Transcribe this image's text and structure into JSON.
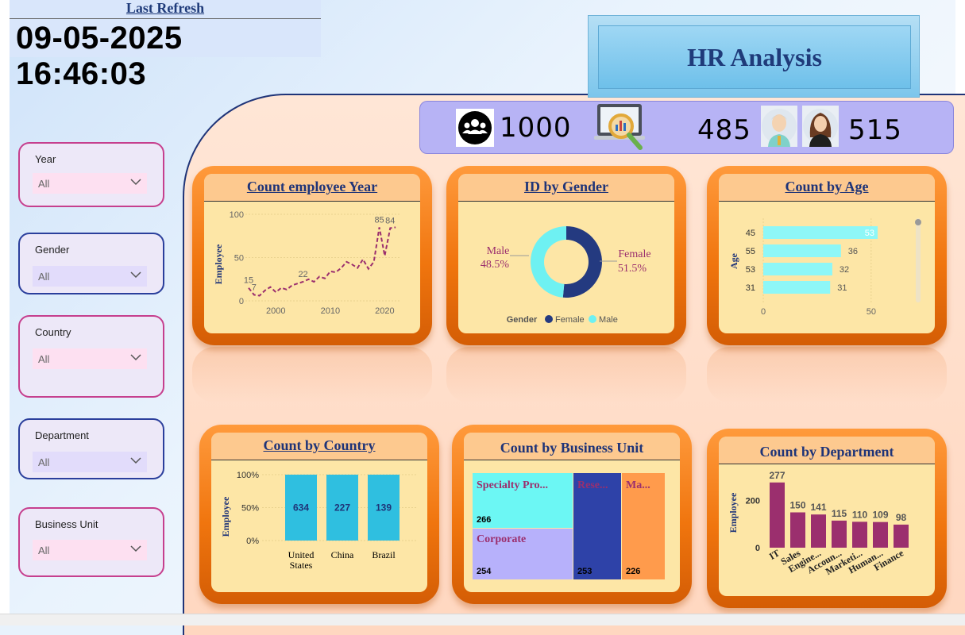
{
  "refresh": {
    "label": "Last Refresh",
    "datetime": "09-05-2025 16:46:03"
  },
  "title": "HR Analysis",
  "kpis": {
    "total": "1000",
    "male": "485",
    "female": "515"
  },
  "icons": {
    "people": "group-people-icon",
    "analytics": "analytics-magnifier-icon",
    "male": "male-avatar-icon",
    "female": "female-avatar-icon",
    "chevron": "chevron-down-icon"
  },
  "slicers": [
    {
      "label": "Year",
      "value": "All"
    },
    {
      "label": "Gender",
      "value": "All"
    },
    {
      "label": "Country",
      "value": "All"
    },
    {
      "label": "Department",
      "value": "All"
    },
    {
      "label": "Business Unit",
      "value": "All"
    }
  ],
  "cards": {
    "year": "Count employee Year",
    "gender": "ID by Gender",
    "age": "Count by Age",
    "country": "Count by Country",
    "business_unit": "Count by Business Unit",
    "department": "Count by Department"
  },
  "colors": {
    "line": "#9b2f6e",
    "donut_female": "#243a80",
    "donut_male": "#6ef1f2",
    "age_bar": "#8ef7f7",
    "country_bar": "#2fbfe0",
    "dept_bar": "#9b2f6e",
    "tm_specialty": "#6cf7f4",
    "tm_corporate": "#b7b1fb",
    "tm_research": "#2e42a8",
    "tm_manufacturing": "#ff9b4c"
  },
  "chart_data": [
    {
      "id": "year",
      "type": "line",
      "title": "Count employee Year",
      "ylabel": "Employee",
      "x_ticks": [
        "2000",
        "2010",
        "2020"
      ],
      "y_ticks": [
        "0",
        "50",
        "100"
      ],
      "ylim": [
        0,
        100
      ],
      "xlim": [
        1995,
        2023
      ],
      "x": [
        1995,
        1996,
        1997,
        1998,
        1999,
        2000,
        2001,
        2002,
        2003,
        2004,
        2005,
        2006,
        2007,
        2008,
        2009,
        2010,
        2011,
        2012,
        2013,
        2014,
        2015,
        2016,
        2017,
        2018,
        2019,
        2020,
        2021,
        2022
      ],
      "values": [
        15,
        7,
        6,
        12,
        16,
        10,
        15,
        13,
        18,
        20,
        22,
        25,
        22,
        28,
        26,
        34,
        33,
        38,
        45,
        42,
        38,
        48,
        37,
        45,
        85,
        52,
        84,
        85
      ],
      "data_labels": [
        {
          "x": 1995,
          "y": 15,
          "text": "15"
        },
        {
          "x": 1996,
          "y": 7,
          "text": "7"
        },
        {
          "x": 2005,
          "y": 22,
          "text": "22"
        },
        {
          "x": 2019,
          "y": 85,
          "text": "85"
        },
        {
          "x": 2021,
          "y": 84,
          "text": "84"
        }
      ]
    },
    {
      "id": "gender",
      "type": "pie",
      "title": "ID by Gender",
      "legend_title": "Gender",
      "slices": [
        {
          "name": "Female",
          "value": 51.5,
          "label": "51.5%"
        },
        {
          "name": "Male",
          "value": 48.5,
          "label": "48.5%"
        }
      ]
    },
    {
      "id": "age",
      "type": "bar",
      "orientation": "horizontal",
      "title": "Count by Age",
      "ylabel": "Age",
      "categories": [
        "45",
        "55",
        "53",
        "31"
      ],
      "values": [
        53,
        36,
        32,
        31
      ],
      "x_ticks": [
        "0",
        "50"
      ],
      "xlim": [
        0,
        60
      ]
    },
    {
      "id": "country",
      "type": "bar",
      "stacked": "100%",
      "title": "Count by Country",
      "ylabel": "Employee",
      "categories": [
        "United States",
        "China",
        "Brazil"
      ],
      "category_lines": [
        [
          "United",
          "States"
        ],
        [
          "China"
        ],
        [
          "Brazil"
        ]
      ],
      "values": [
        634,
        227,
        139
      ],
      "y_ticks": [
        "0%",
        "50%",
        "100%"
      ]
    },
    {
      "id": "business_unit",
      "type": "treemap",
      "title": "Count by Business Unit",
      "items": [
        {
          "name": "Specialty Pro...",
          "value": 266
        },
        {
          "name": "Corporate",
          "value": 254
        },
        {
          "name": "Rese...",
          "value": 253
        },
        {
          "name": "Ma...",
          "value": 226
        }
      ]
    },
    {
      "id": "department",
      "type": "bar",
      "title": "Count by Department",
      "ylabel": "Employee",
      "categories": [
        "IT",
        "Sales",
        "Engine...",
        "Accoun...",
        "Marketi...",
        "Human...",
        "Finance"
      ],
      "values": [
        277,
        150,
        141,
        115,
        110,
        109,
        98
      ],
      "y_ticks": [
        "0",
        "200"
      ],
      "ylim": [
        0,
        300
      ]
    }
  ]
}
